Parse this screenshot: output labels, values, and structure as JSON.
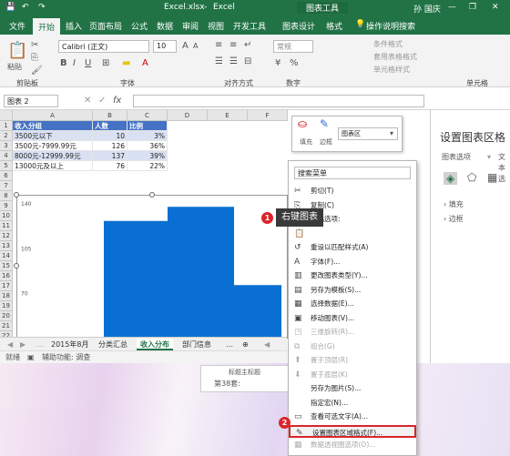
{
  "titlebar": {
    "filename": "Excel.xlsx",
    "separator": "-",
    "app": "Excel",
    "context_tool": "图表工具",
    "user": "孙 国庆",
    "minimize": "—",
    "restore": "❐",
    "close": "✕"
  },
  "ribbon_tabs": [
    "文件",
    "开始",
    "插入",
    "页面布局",
    "公式",
    "数据",
    "审阅",
    "视图",
    "开发工具",
    "图表设计",
    "格式"
  ],
  "tell_me": "操作说明搜索",
  "font": {
    "name": "Calibri (正文)",
    "size": "10",
    "bold": "B",
    "italic": "I",
    "underline": "U"
  },
  "number_format": "常规",
  "groups": {
    "clipboard": "剪贴板",
    "paste": "粘贴",
    "font": "字体",
    "align": "对齐方式",
    "number": "数字",
    "cell": "单元格",
    "cond_format": "条件格式",
    "table_format": "套用表格格式",
    "cell_style": "单元格样式"
  },
  "name_box": "图表 2",
  "fx": "fx",
  "columns": [
    "A",
    "B",
    "C",
    "D",
    "E",
    "F"
  ],
  "table": {
    "headers": [
      "收入分组",
      "人数",
      "比例"
    ],
    "rows": [
      [
        "3500元以下",
        "10",
        "3%"
      ],
      [
        "3500元-7999.99元",
        "126",
        "36%"
      ],
      [
        "8000元-12999.99元",
        "137",
        "39%"
      ],
      [
        "13000元及以上",
        "76",
        "22%"
      ]
    ],
    "row_numbers": [
      "1",
      "2",
      "3",
      "4",
      "5",
      "6",
      "7",
      "8",
      "9",
      "10",
      "11",
      "12",
      "13",
      "14",
      "15",
      "16",
      "17",
      "18",
      "19",
      "20",
      "21",
      "22"
    ]
  },
  "chart_data": {
    "type": "area",
    "y_ticks": [
      "140",
      "105",
      "70"
    ],
    "ylim": [
      35,
      140
    ],
    "values": [
      126,
      137,
      76
    ],
    "color": "#0a6fd3"
  },
  "sheet_tabs": [
    "2015年8月",
    "分类汇总",
    "收入分布",
    "部门信息"
  ],
  "active_sheet": "收入分布",
  "status": {
    "ready": "就绪",
    "accessibility": "辅助功能: 调查"
  },
  "fill_popup": {
    "fill": "填充",
    "outline": "边框",
    "area": "图表区"
  },
  "context_menu": {
    "search": "搜索菜单",
    "items": [
      {
        "icon": "✂",
        "label": "剪切(T)",
        "disabled": false
      },
      {
        "icon": "⎘",
        "label": "复制(C)",
        "disabled": false
      },
      {
        "icon": "",
        "label": "粘贴选项:",
        "disabled": false
      },
      {
        "icon": "📋",
        "label": "",
        "disabled": false
      },
      {
        "icon": "↺",
        "label": "重设以匹配样式(A)",
        "disabled": false
      },
      {
        "icon": "A",
        "label": "字体(F)...",
        "disabled": false
      },
      {
        "icon": "▥",
        "label": "更改图表类型(Y)...",
        "disabled": false
      },
      {
        "icon": "▤",
        "label": "另存为模板(S)...",
        "disabled": false
      },
      {
        "icon": "▦",
        "label": "选择数据(E)...",
        "disabled": false
      },
      {
        "icon": "▣",
        "label": "移动图表(V)...",
        "disabled": false
      },
      {
        "icon": "◳",
        "label": "三维旋转(R)...",
        "disabled": true
      },
      {
        "icon": "⧉",
        "label": "组合(G)",
        "disabled": true
      },
      {
        "icon": "⬆",
        "label": "置于顶层(R)",
        "disabled": true
      },
      {
        "icon": "⬇",
        "label": "置于底层(K)",
        "disabled": true
      },
      {
        "icon": "",
        "label": "另存为图片(S)...",
        "disabled": false
      },
      {
        "icon": "",
        "label": "指定宏(N)...",
        "disabled": false
      },
      {
        "icon": "▭",
        "label": "查看可选文字(A)...",
        "disabled": false
      },
      {
        "icon": "✎",
        "label": "设置图表区域格式(F)...",
        "disabled": false
      },
      {
        "icon": "▦",
        "label": "数据透视图选项(O)...",
        "disabled": true
      }
    ]
  },
  "callout": {
    "badge1": "1",
    "text": "右键图表",
    "badge2": "2"
  },
  "side_panel": {
    "title": "设置图表区格",
    "tab1": "图表选项",
    "tab2": "文本选",
    "sec1": "填充",
    "sec2": "边框"
  },
  "bg_text": {
    "line1": "标题主标题",
    "line2": "第38套:"
  },
  "colors": {
    "excel_green": "#217346",
    "table_header": "#4472c4",
    "table_row": "#d9e1f2",
    "highlight": "#d9262a"
  }
}
